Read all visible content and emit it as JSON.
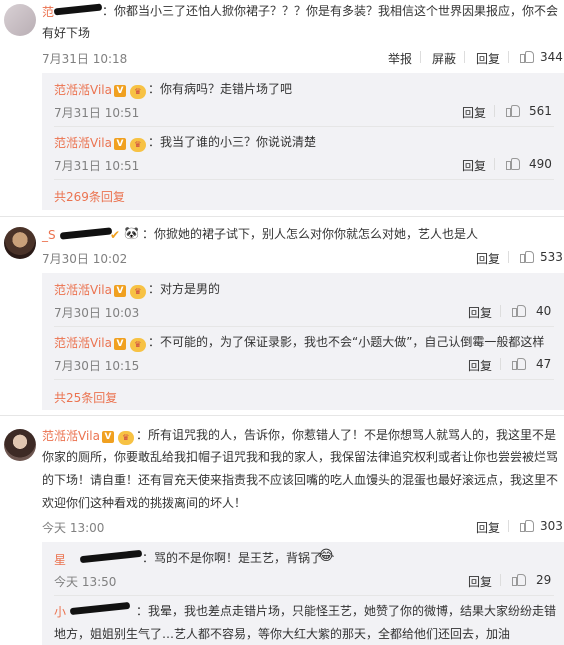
{
  "c1": {
    "name_visible": "范",
    "text_line1": "：你都当小三了还怕人掀你裙子？？？你是有多装？我相信这个世界因果报应，你不会",
    "text_line2": "有好下场",
    "time": "7月31日 10:18",
    "report": "举报",
    "block": "屏蔽",
    "reply": "回复",
    "likes": "344"
  },
  "r1": {
    "name": "范湉湉Vila",
    "text": "：你有病吗？走错片场了吧",
    "time": "7月31日 10:51",
    "reply": "回复",
    "likes": "561"
  },
  "r2": {
    "name": "范湉湉Vila",
    "text": "：我当了谁的小三？你说说清楚",
    "time": "7月31日 10:51",
    "reply": "回复",
    "likes": "490"
  },
  "more1": "共269条回复",
  "c2": {
    "name_visible": "_S",
    "text": "：你掀她的裙子试下，别人怎么对你你就怎么对她，艺人也是人",
    "time": "7月30日 10:02",
    "reply": "回复",
    "likes": "533"
  },
  "r3": {
    "name": "范湉湉Vila",
    "text": "：对方是男的",
    "time": "7月30日 10:03",
    "reply": "回复",
    "likes": "40"
  },
  "r4": {
    "name": "范湉湉Vila",
    "text": "：不可能的，为了保证录影，我也不会“小题大做”，自己认倒霉一般都这样",
    "time": "7月30日 10:15",
    "reply": "回复",
    "likes": "47"
  },
  "more2": "共25条回复",
  "c3": {
    "name": "范湉湉Vila",
    "line1": "：所有诅咒我的人，告诉你，你惹错人了！不是你想骂人就骂人的，我这里不是",
    "line2": "你家的厕所，你要敢乱给我扣帽子诅咒我和我的家人，我保留法律追究权利或者让你也尝尝被烂骂",
    "line3": "的下场！请自重！还有冒充天使来指责我不应该回嘴的吃人血馒头的混蛋也最好滚远点，我这里不",
    "line4": "欢迎你们这种看戏的挑拨离间的坏人！",
    "time": "今天 13:00",
    "reply": "回复",
    "likes": "303"
  },
  "r5": {
    "name_visible": "星",
    "text": "：骂的不是你啊！是王艺，背锅了",
    "emoji": "😂",
    "time": "今天 13:50",
    "reply": "回复",
    "likes": "29"
  },
  "r6": {
    "name_visible": "小",
    "line1": "：我晕，我也差点走错片场，只能怪王艺，她赞了你的微博，结果大家纷纷走错",
    "line2": "地方，姐姐别生气了…艺人都不容易，等你大红大紫的那天，全都给他们还回去，加油"
  },
  "colors": {
    "link": "#eb7350",
    "reply_bg": "#f2f2f5",
    "time": "#808080"
  }
}
